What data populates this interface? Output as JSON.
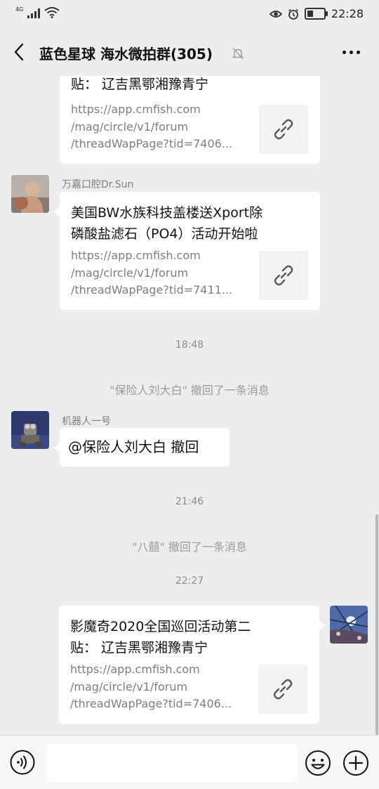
{
  "status_bar": {
    "network": "4G",
    "time": "22:28",
    "battery_level": 0.35
  },
  "header": {
    "title": "蓝色星球 海水微拍群(305)"
  },
  "messages": [
    {
      "type": "link_card",
      "side": "left",
      "title_lines": [
        "贴：  辽吉黑鄂湘豫青宁"
      ],
      "url_lines": [
        "https://app.cmfish.com",
        "/mag/circle/v1/forum",
        "/threadWapPage?tid=7406..."
      ]
    },
    {
      "type": "link_card",
      "side": "left",
      "sender": "万嘉口腔Dr.Sun",
      "title_lines": [
        "美国BW水族科技盖楼送Xport除",
        "磷酸盐滤石（PO4）活动开始啦"
      ],
      "url_lines": [
        "https://app.cmfish.com",
        "/mag/circle/v1/forum",
        "/threadWapPage?tid=7411..."
      ]
    },
    {
      "type": "time",
      "text": "18:48"
    },
    {
      "type": "system",
      "text": "\"保险人刘大白\" 撤回了一条消息"
    },
    {
      "type": "text",
      "side": "left",
      "sender": "机器人一号",
      "text": "@保险人刘大白  撤回"
    },
    {
      "type": "time",
      "text": "21:46"
    },
    {
      "type": "system",
      "text": "\"八囍\" 撤回了一条消息"
    },
    {
      "type": "time",
      "text": "22:27"
    },
    {
      "type": "link_card",
      "side": "right",
      "title_lines": [
        "影魔奇2020全国巡回活动第二",
        "贴：  辽吉黑鄂湘豫青宁"
      ],
      "url_lines": [
        "https://app.cmfish.com",
        "/mag/circle/v1/forum",
        "/threadWapPage?tid=7406..."
      ]
    }
  ],
  "input_bar": {
    "placeholder": ""
  },
  "colors": {
    "background": "#ededed",
    "bubble": "#ffffff",
    "timestamp": "#8a8a8a",
    "url_text": "#7d7d7d"
  }
}
